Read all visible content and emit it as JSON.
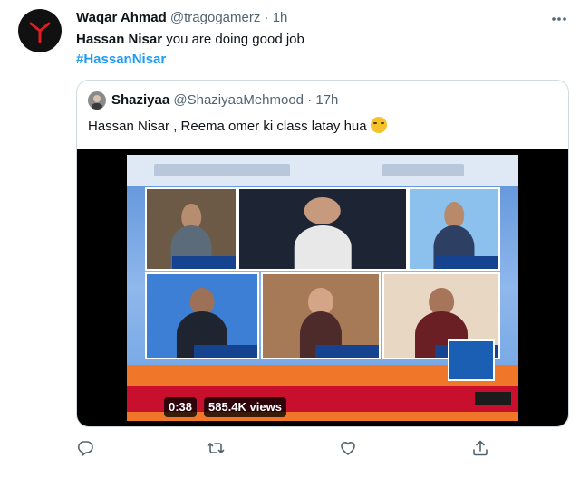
{
  "tweet": {
    "author_name": "Waqar Ahmad",
    "author_handle": "@tragogamerz",
    "separator": "·",
    "time": "1h",
    "text_bold": "Hassan Nisar",
    "text_rest": " you are doing good job",
    "hashtag": "#HassanNisar"
  },
  "quote": {
    "author_name": "Shaziyaa",
    "author_handle": "@ShaziyaaMehmood",
    "separator": "·",
    "time": "17h",
    "text": "Hassan Nisar , Reema omer ki class latay hua",
    "video_time": "0:38",
    "video_views": "585.4K views"
  },
  "colors": {
    "link": "#1d9bf0",
    "muted": "#536471",
    "border": "#cfd9de"
  },
  "icons": [
    "more-icon",
    "reply-icon",
    "retweet-icon",
    "like-icon",
    "share-icon",
    "laughing-emoji-icon"
  ]
}
